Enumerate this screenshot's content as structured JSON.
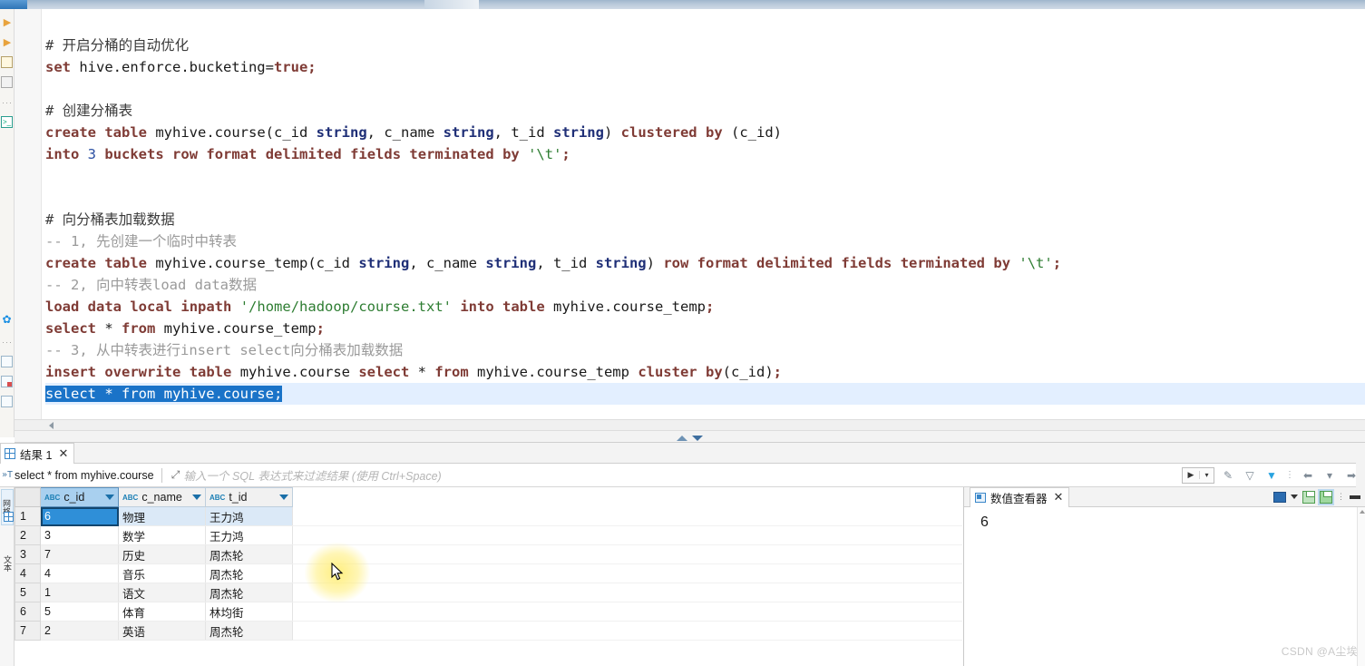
{
  "editor": {
    "lines": [
      {
        "id": 1,
        "tokens": [
          {
            "t": "# 开启分桶的自动优化",
            "c": "cmt"
          }
        ]
      },
      {
        "id": 2,
        "tokens": [
          {
            "t": "set",
            "c": "kw"
          },
          {
            "t": " hive.enforce.bucketing=",
            "c": "pln"
          },
          {
            "t": "true",
            "c": "kw"
          },
          {
            "t": ";",
            "c": "kw"
          }
        ]
      },
      {
        "id": 3,
        "tokens": []
      },
      {
        "id": 4,
        "tokens": [
          {
            "t": "# 创建分桶表",
            "c": "cmt"
          }
        ]
      },
      {
        "id": 5,
        "tokens": [
          {
            "t": "create",
            "c": "kw"
          },
          {
            "t": " ",
            "c": "pln"
          },
          {
            "t": "table",
            "c": "kw"
          },
          {
            "t": " myhive.course(c_id ",
            "c": "pln"
          },
          {
            "t": "string",
            "c": "kw2"
          },
          {
            "t": ", c_name ",
            "c": "pln"
          },
          {
            "t": "string",
            "c": "kw2"
          },
          {
            "t": ", t_id ",
            "c": "pln"
          },
          {
            "t": "string",
            "c": "kw2"
          },
          {
            "t": ") ",
            "c": "pln"
          },
          {
            "t": "clustered",
            "c": "kw"
          },
          {
            "t": " ",
            "c": "pln"
          },
          {
            "t": "by",
            "c": "kw"
          },
          {
            "t": " (c_id)",
            "c": "pln"
          }
        ]
      },
      {
        "id": 6,
        "tokens": [
          {
            "t": "into",
            "c": "kw"
          },
          {
            "t": " ",
            "c": "pln"
          },
          {
            "t": "3",
            "c": "num"
          },
          {
            "t": " ",
            "c": "pln"
          },
          {
            "t": "buckets",
            "c": "kw"
          },
          {
            "t": " ",
            "c": "pln"
          },
          {
            "t": "row",
            "c": "kw"
          },
          {
            "t": " ",
            "c": "pln"
          },
          {
            "t": "format",
            "c": "kw"
          },
          {
            "t": " ",
            "c": "pln"
          },
          {
            "t": "delimited",
            "c": "kw"
          },
          {
            "t": " ",
            "c": "pln"
          },
          {
            "t": "fields",
            "c": "kw"
          },
          {
            "t": " ",
            "c": "pln"
          },
          {
            "t": "terminated",
            "c": "kw"
          },
          {
            "t": " ",
            "c": "pln"
          },
          {
            "t": "by",
            "c": "kw"
          },
          {
            "t": " ",
            "c": "pln"
          },
          {
            "t": "'\\t'",
            "c": "str"
          },
          {
            "t": ";",
            "c": "kw"
          }
        ]
      },
      {
        "id": 7,
        "tokens": []
      },
      {
        "id": 8,
        "tokens": []
      },
      {
        "id": 9,
        "tokens": [
          {
            "t": "# 向分桶表加载数据",
            "c": "cmt"
          }
        ]
      },
      {
        "id": 10,
        "tokens": [
          {
            "t": "-- 1, 先创建一个临时中转表",
            "c": "cmt2"
          }
        ]
      },
      {
        "id": 11,
        "tokens": [
          {
            "t": "create",
            "c": "kw"
          },
          {
            "t": " ",
            "c": "pln"
          },
          {
            "t": "table",
            "c": "kw"
          },
          {
            "t": " myhive.course_temp(c_id ",
            "c": "pln"
          },
          {
            "t": "string",
            "c": "kw2"
          },
          {
            "t": ", c_name ",
            "c": "pln"
          },
          {
            "t": "string",
            "c": "kw2"
          },
          {
            "t": ", t_id ",
            "c": "pln"
          },
          {
            "t": "string",
            "c": "kw2"
          },
          {
            "t": ") ",
            "c": "pln"
          },
          {
            "t": "row",
            "c": "kw"
          },
          {
            "t": " ",
            "c": "pln"
          },
          {
            "t": "format",
            "c": "kw"
          },
          {
            "t": " ",
            "c": "pln"
          },
          {
            "t": "delimited",
            "c": "kw"
          },
          {
            "t": " ",
            "c": "pln"
          },
          {
            "t": "fields",
            "c": "kw"
          },
          {
            "t": " ",
            "c": "pln"
          },
          {
            "t": "terminated",
            "c": "kw"
          },
          {
            "t": " ",
            "c": "pln"
          },
          {
            "t": "by",
            "c": "kw"
          },
          {
            "t": " ",
            "c": "pln"
          },
          {
            "t": "'\\t'",
            "c": "str"
          },
          {
            "t": ";",
            "c": "kw"
          }
        ]
      },
      {
        "id": 12,
        "tokens": [
          {
            "t": "-- 2, 向中转表load data数据",
            "c": "cmt2"
          }
        ]
      },
      {
        "id": 13,
        "tokens": [
          {
            "t": "load",
            "c": "kw"
          },
          {
            "t": " ",
            "c": "pln"
          },
          {
            "t": "data",
            "c": "kw"
          },
          {
            "t": " ",
            "c": "pln"
          },
          {
            "t": "local",
            "c": "kw"
          },
          {
            "t": " ",
            "c": "pln"
          },
          {
            "t": "inpath",
            "c": "kw"
          },
          {
            "t": " ",
            "c": "pln"
          },
          {
            "t": "'/home/hadoop/course.txt'",
            "c": "str"
          },
          {
            "t": " ",
            "c": "pln"
          },
          {
            "t": "into",
            "c": "kw"
          },
          {
            "t": " ",
            "c": "pln"
          },
          {
            "t": "table",
            "c": "kw"
          },
          {
            "t": " myhive.course_temp",
            "c": "pln"
          },
          {
            "t": ";",
            "c": "kw"
          }
        ]
      },
      {
        "id": 14,
        "tokens": [
          {
            "t": "select",
            "c": "kw"
          },
          {
            "t": " * ",
            "c": "pln"
          },
          {
            "t": "from",
            "c": "kw"
          },
          {
            "t": " myhive.course_temp",
            "c": "pln"
          },
          {
            "t": ";",
            "c": "kw"
          }
        ]
      },
      {
        "id": 15,
        "tokens": [
          {
            "t": "-- 3, 从中转表进行insert select向分桶表加载数据",
            "c": "cmt2"
          }
        ]
      },
      {
        "id": 16,
        "tokens": [
          {
            "t": "insert",
            "c": "kw"
          },
          {
            "t": " ",
            "c": "pln"
          },
          {
            "t": "overwrite",
            "c": "kw"
          },
          {
            "t": " ",
            "c": "pln"
          },
          {
            "t": "table",
            "c": "kw"
          },
          {
            "t": " myhive.course ",
            "c": "pln"
          },
          {
            "t": "select",
            "c": "kw"
          },
          {
            "t": " * ",
            "c": "pln"
          },
          {
            "t": "from",
            "c": "kw"
          },
          {
            "t": " myhive.course_temp ",
            "c": "pln"
          },
          {
            "t": "cluster",
            "c": "kw"
          },
          {
            "t": " ",
            "c": "pln"
          },
          {
            "t": "by",
            "c": "kw"
          },
          {
            "t": "(c_id)",
            "c": "pln"
          },
          {
            "t": ";",
            "c": "kw"
          }
        ]
      },
      {
        "id": 17,
        "selected": true,
        "text": "select * from myhive.course;"
      }
    ]
  },
  "left_toolbar": {
    "items": [
      {
        "name": "execute-statement",
        "label": "▶"
      },
      {
        "name": "execute-script",
        "label": "▶"
      },
      {
        "name": "execute-in-new-tab",
        "label": "▶"
      },
      {
        "name": "explain-execution-plan",
        "label": "▤"
      },
      {
        "name": "toolbar-overflow",
        "label": "···"
      },
      {
        "name": "open-sql-console",
        "label": ">_"
      },
      {
        "name": "configure-tool",
        "label": "⚙"
      },
      {
        "name": "more-options",
        "label": "···"
      },
      {
        "name": "export-to-file",
        "label": "⇥"
      },
      {
        "name": "import-from-file",
        "label": "⬇"
      },
      {
        "name": "script-options",
        "label": "((•))"
      }
    ]
  },
  "results_tab": {
    "label": "结果 1",
    "close": "✕"
  },
  "filter_bar": {
    "lead_icon": "»T",
    "query": "select * from myhive.course",
    "expand_icon": "⤢",
    "placeholder": "输入一个 SQL 表达式来过滤结果 (使用 Ctrl+Space)",
    "play": "▶",
    "play_dropdown": "▾",
    "clear_filter_icon": "✎",
    "save_filter_icon": "▽",
    "apply_filter_icon": "▼",
    "dots": "⋮",
    "prev": "⬅",
    "prev_dropdown": "▾",
    "next": "➡"
  },
  "vertical_tabs": {
    "grid_label": "网格",
    "text_label": "文本"
  },
  "grid": {
    "row_header": "",
    "columns": [
      {
        "name": "c_id",
        "type_badge": "ABC",
        "selected": true
      },
      {
        "name": "c_name",
        "type_badge": "ABC",
        "selected": false
      },
      {
        "name": "t_id",
        "type_badge": "ABC",
        "selected": false
      }
    ],
    "rows": [
      {
        "n": "1",
        "c_id": "6",
        "c_name": "物理",
        "t_id": "王力鸿",
        "selected": true
      },
      {
        "n": "2",
        "c_id": "3",
        "c_name": "数学",
        "t_id": "王力鸿",
        "selected": false
      },
      {
        "n": "3",
        "c_id": "7",
        "c_name": "历史",
        "t_id": "周杰轮",
        "selected": false
      },
      {
        "n": "4",
        "c_id": "4",
        "c_name": "音乐",
        "t_id": "周杰轮",
        "selected": false
      },
      {
        "n": "5",
        "c_id": "1",
        "c_name": "语文",
        "t_id": "周杰轮",
        "selected": false
      },
      {
        "n": "6",
        "c_id": "5",
        "c_name": "体育",
        "t_id": "林均街",
        "selected": false
      },
      {
        "n": "7",
        "c_id": "2",
        "c_name": "英语",
        "t_id": "周杰轮",
        "selected": false
      }
    ]
  },
  "value_viewer": {
    "tab_label": "数值查看器",
    "close": "✕",
    "value": "6",
    "toolbar": {
      "view_as": "book-icon",
      "view_as_dropdown": "▾",
      "save_value": "save-icon",
      "load_value": "load-icon",
      "dots": "⋮",
      "minimize": "▭"
    }
  },
  "watermark": "CSDN @A尘埃"
}
